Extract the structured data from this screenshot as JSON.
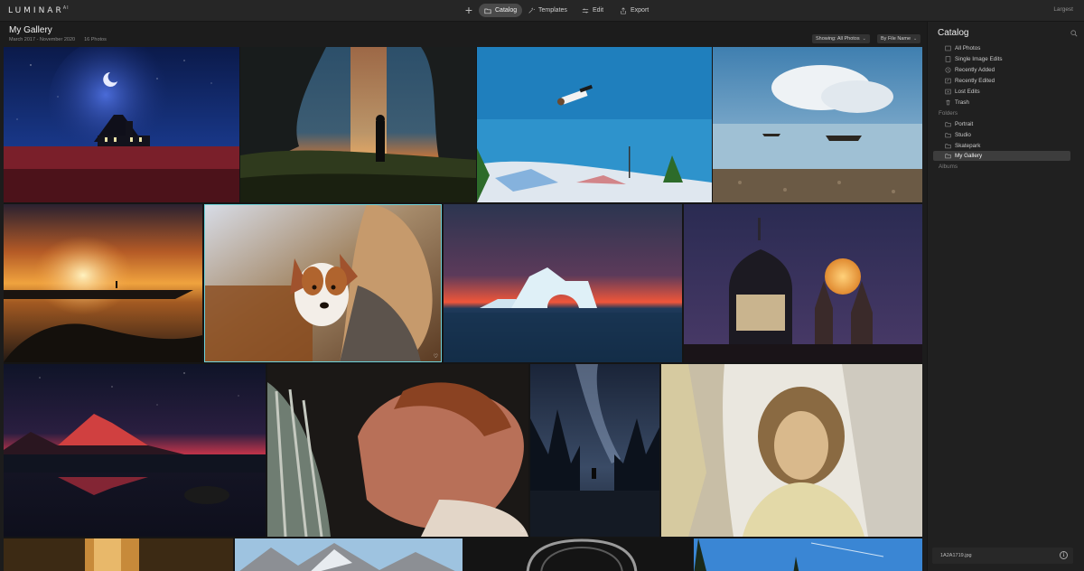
{
  "app": {
    "logo": "LUMINAR",
    "logo_suffix": "AI",
    "nav": [
      {
        "label": "Catalog",
        "icon": "folder-icon",
        "active": true
      },
      {
        "label": "Templates",
        "icon": "magic-wand-icon",
        "active": false
      },
      {
        "label": "Edit",
        "icon": "sliders-icon",
        "active": false
      },
      {
        "label": "Export",
        "icon": "share-icon",
        "active": false
      }
    ],
    "add_label": "+",
    "thumbnail_size": "Largest"
  },
  "header": {
    "title": "My Gallery",
    "date_range": "March 2017 - November 2020",
    "photo_count": "16 Photos",
    "filter": "Showing: All Photos",
    "sort": "By File Name"
  },
  "gallery": {
    "selected_index": 5,
    "favorites": [
      5,
      9
    ]
  },
  "sidebar": {
    "title": "Catalog",
    "catalog_items": [
      {
        "label": "All Photos",
        "icon": "photos-icon"
      },
      {
        "label": "Single Image Edits",
        "icon": "single-image-icon"
      },
      {
        "label": "Recently Added",
        "icon": "clock-icon"
      },
      {
        "label": "Recently Edited",
        "icon": "edit-history-icon"
      },
      {
        "label": "Lost Edits",
        "icon": "lost-edits-icon"
      },
      {
        "label": "Trash",
        "icon": "trash-icon"
      }
    ],
    "folders_label": "Folders",
    "folders": [
      {
        "label": "Portrait",
        "active": false
      },
      {
        "label": "Studio",
        "active": false
      },
      {
        "label": "Skatepark",
        "active": false
      },
      {
        "label": "My Gallery",
        "active": true
      }
    ],
    "albums_label": "Albums",
    "file_name": "1A2A1719.jpg"
  },
  "colors": {
    "accent_selected": "#6fd2d9",
    "background": "#1c1c1c",
    "sidebar": "#202020"
  }
}
